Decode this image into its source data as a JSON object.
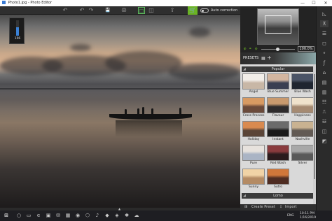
{
  "window": {
    "title": "Photo1.jpg - Photo Editor",
    "minimize": "—",
    "maximize": "☐",
    "close": "✕"
  },
  "toolbar": {
    "undo_icon": "↶",
    "undo2_icon": "↶",
    "redo_icon": "↷",
    "save_icon": "💾",
    "print_icon": "🖨",
    "view1_icon": "▢",
    "view2_icon": "◫",
    "share_icon": "⇪",
    "cart_icon": "🛒",
    "auto_correction_label": "Auto correction"
  },
  "overlay": {
    "value": "106",
    "level_fraction": 0.55
  },
  "navigator": {
    "zoom_value": "100.0%",
    "zoom_out_icon": "⚘",
    "zoom_in_icon": "⚘",
    "knob_fraction": 0.47
  },
  "presets": {
    "header_label": "PRESETS",
    "grid_icon": "▦",
    "add_icon": "+",
    "groups": [
      {
        "name": "Popular",
        "items": [
          {
            "name": "Angel",
            "c1": "#f2eee9",
            "c2": "#c8b7a6"
          },
          {
            "name": "Blue Summer",
            "c1": "#d3b6a0",
            "c2": "#3a3f52"
          },
          {
            "name": "Blue Wash",
            "c1": "#4b5466",
            "c2": "#1f2530"
          },
          {
            "name": "Cross Process",
            "c1": "#d89a62",
            "c2": "#6b4a3a"
          },
          {
            "name": "Flavour",
            "c1": "#c99a6e",
            "c2": "#2e2b2c"
          },
          {
            "name": "Happiness",
            "c1": "#efe2cc",
            "c2": "#a58a72"
          },
          {
            "name": "Holiday",
            "c1": "#d98a4f",
            "c2": "#5a4538"
          },
          {
            "name": "Instant",
            "c1": "#6b6b6b",
            "c2": "#1a1a1a"
          },
          {
            "name": "Nashville",
            "c1": "#c9b291",
            "c2": "#625a54"
          },
          {
            "name": "Pure",
            "c1": "#e7e2dd",
            "c2": "#aab4c4"
          },
          {
            "name": "Red Wash",
            "c1": "#8a3b3e",
            "c2": "#2b1b1d"
          },
          {
            "name": "Silver",
            "c1": "#a8a8a8",
            "c2": "#595959"
          },
          {
            "name": "Sunny",
            "c1": "#f1d3a6",
            "c2": "#b48b64"
          },
          {
            "name": "Sutro",
            "c1": "#d0773a",
            "c2": "#4e2c22"
          }
        ]
      },
      {
        "name": "Lomo",
        "items": []
      }
    ],
    "create_preset_label": "Create Preset",
    "import_label": "Import"
  },
  "right_icons": [
    "◺",
    "⊼",
    "☰",
    "◻",
    "⚬",
    "ƒ",
    "⌂",
    "▤",
    "▥",
    "☷",
    "⎍",
    "☳",
    "◫",
    "◩"
  ],
  "taskbar": {
    "start_icon": "⊞",
    "apps": [
      "○",
      "▭",
      "e",
      "▣",
      "✉",
      "▦",
      "◉",
      "⬡",
      "♪",
      "◆",
      "◈",
      "✱",
      "☁"
    ],
    "language": "ENG",
    "time": "10:11 PM",
    "date": "1/16/2019"
  }
}
